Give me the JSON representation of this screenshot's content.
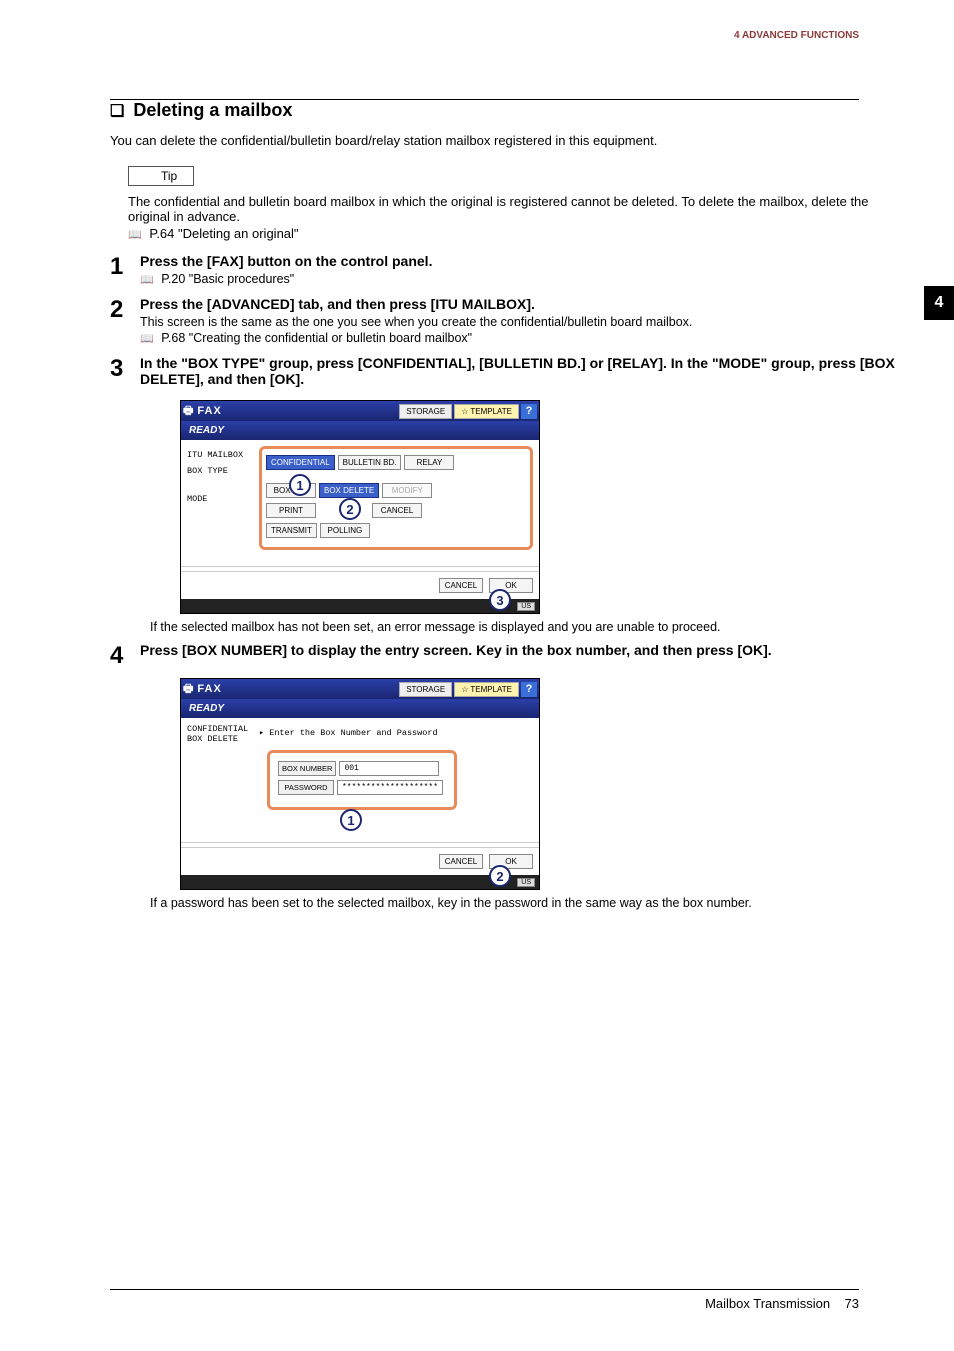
{
  "header": {
    "chapter": "4 ADVANCED FUNCTIONS"
  },
  "side_tab": "4",
  "section": {
    "title": "Deleting a mailbox",
    "intro": "You can delete the confidential/bulletin board/relay station mailbox registered in this equipment."
  },
  "tip": {
    "label": "Tip",
    "text": "The confidential and bulletin board mailbox in which the original is registered cannot be deleted. To delete the mailbox, delete the original in advance.",
    "ref": "P.64 \"Deleting an original\""
  },
  "steps": [
    {
      "num": "1",
      "title": "Press the [FAX] button on the control panel.",
      "ref": "P.20 \"Basic procedures\""
    },
    {
      "num": "2",
      "title": "Press the [ADVANCED] tab, and then press [ITU MAILBOX].",
      "sub": "This screen is the same as the one you see when you create the confidential/bulletin board mailbox.",
      "ref": "P.68 \"Creating the confidential or bulletin board mailbox\""
    },
    {
      "num": "3",
      "title": "In the \"BOX TYPE\" group, press [CONFIDENTIAL], [BULLETIN BD.] or [RELAY]. In the \"MODE\" group, press [BOX DELETE], and then [OK].",
      "note": "If the selected mailbox has not been set, an error message is displayed and you are unable to proceed."
    },
    {
      "num": "4",
      "title": "Press [BOX NUMBER] to display the entry screen. Key in the box number, and then press [OK].",
      "note": "If a password has been set to the selected mailbox, key in the password in the same way as the box number."
    }
  ],
  "screenshot1": {
    "title": "FAX",
    "storage": "STORAGE",
    "template": "TEMPLATE",
    "help": "?",
    "breadcrumb": "READY",
    "left_labels": {
      "l1": "ITU MAILBOX",
      "l2": "BOX TYPE",
      "l3": "MODE"
    },
    "box_type": {
      "b1": "CONFIDENTIAL",
      "b2": "BULLETIN BD.",
      "b3": "RELAY"
    },
    "mode_row1": {
      "m1": "BOX SET",
      "m2": "BOX DELETE",
      "m3": "MODIFY"
    },
    "mode_row2": {
      "m1": "PRINT",
      "m2": "",
      "m3": "CANCEL"
    },
    "mode_row3": {
      "m1": "TRANSMIT",
      "m2": "POLLING"
    },
    "footer": {
      "cancel": "CANCEL",
      "ok": "OK"
    },
    "status": "US",
    "callouts": {
      "c1": "1",
      "c2": "2",
      "c3": "3"
    }
  },
  "screenshot2": {
    "title": "FAX",
    "storage": "STORAGE",
    "template": "TEMPLATE",
    "help": "?",
    "breadcrumb": "READY",
    "left_labels": {
      "l1": "CONFIDENTIAL",
      "l2": "BOX DELETE"
    },
    "prompt": "Enter the Box Number and Password",
    "inputs": {
      "box_number_label": "BOX NUMBER",
      "box_number_value": "001",
      "password_label": "PASSWORD",
      "password_value": "********************"
    },
    "footer": {
      "cancel": "CANCEL",
      "ok": "OK"
    },
    "status": "US",
    "callouts": {
      "c1": "1",
      "c2": "2"
    }
  },
  "footer": {
    "section": "Mailbox Transmission",
    "page": "73"
  }
}
